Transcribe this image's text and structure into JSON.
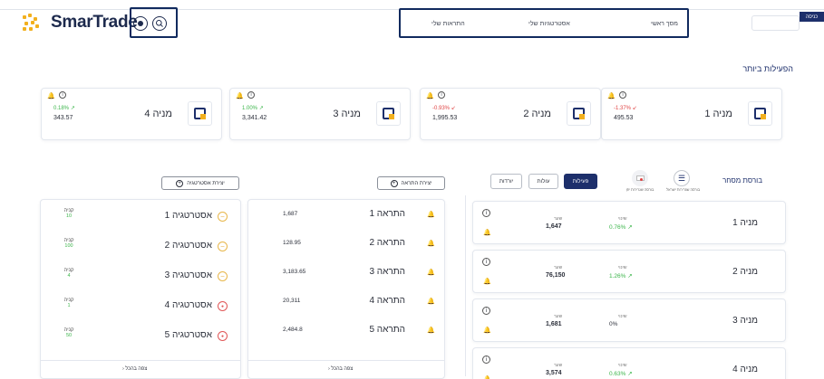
{
  "header": {
    "brand": "SmarTrade",
    "nav": [
      "מסך ראשי",
      "אסטרטגיות שלי",
      "התראות שלי"
    ],
    "login_label": "כניסה"
  },
  "top_active": {
    "title": "הפעילות ביותר",
    "cards": [
      {
        "name": "מניה 1",
        "change": "-1.37%",
        "direction": "down",
        "price": "495.53"
      },
      {
        "name": "מניה 2",
        "change": "-0.93%",
        "direction": "down",
        "price": "1,995.53"
      },
      {
        "name": "מניה 3",
        "change": "1.00%",
        "direction": "up",
        "price": "3,341.42"
      },
      {
        "name": "מניה 4",
        "change": "0.18%",
        "direction": "up",
        "price": "343.57"
      }
    ]
  },
  "market": {
    "title": "בורסת מסחר",
    "exchanges": [
      "בורסה שגרירות ישראל",
      "בורסה שגרירות יפן"
    ],
    "tabs": [
      {
        "label": "פעילות",
        "active": true
      },
      {
        "label": "עולות",
        "active": false
      },
      {
        "label": "יורדות",
        "active": false
      }
    ],
    "col_price": "שער",
    "col_change": "שינוי",
    "rows": [
      {
        "name": "מניה 1",
        "price": "1,647",
        "change": "0.76%",
        "direction": "up"
      },
      {
        "name": "מניה 2",
        "price": "76,150",
        "change": "1.26%",
        "direction": "up"
      },
      {
        "name": "מניה 3",
        "price": "1,681",
        "change": "0%",
        "direction": "flat"
      },
      {
        "name": "מניה 4",
        "price": "3,574",
        "change": "0.63%",
        "direction": "up"
      }
    ]
  },
  "alerts": {
    "create_label": "יצירת התראה",
    "items": [
      {
        "name": "התראה 1",
        "value": "1,687"
      },
      {
        "name": "התראה 2",
        "value": "128.95"
      },
      {
        "name": "התראה 3",
        "value": "3,183.65"
      },
      {
        "name": "התראה 4",
        "value": "20,311"
      },
      {
        "name": "התראה 5",
        "value": "2,484.8"
      }
    ],
    "more_label": "צפה בהכל"
  },
  "strategies": {
    "create_label": "יצירת אסטרטגיה",
    "action_label": "קניה",
    "items": [
      {
        "name": "אסטרטגיה 1",
        "status": "yellow",
        "sub": "10"
      },
      {
        "name": "אסטרטגיה 2",
        "status": "yellow",
        "sub": "100"
      },
      {
        "name": "אסטרטגיה 3",
        "status": "yellow",
        "sub": "4"
      },
      {
        "name": "אסטרטגיה 4",
        "status": "red",
        "sub": "1"
      },
      {
        "name": "אסטרטגיה 5",
        "status": "red",
        "sub": "50"
      }
    ],
    "more_label": "צפה בהכל"
  },
  "colors": {
    "brand": "#1d2f6b",
    "up": "#3bb54a",
    "down": "#e04545",
    "logo_yellow": "#f2b01e",
    "highlight_border": "#112a5e"
  }
}
